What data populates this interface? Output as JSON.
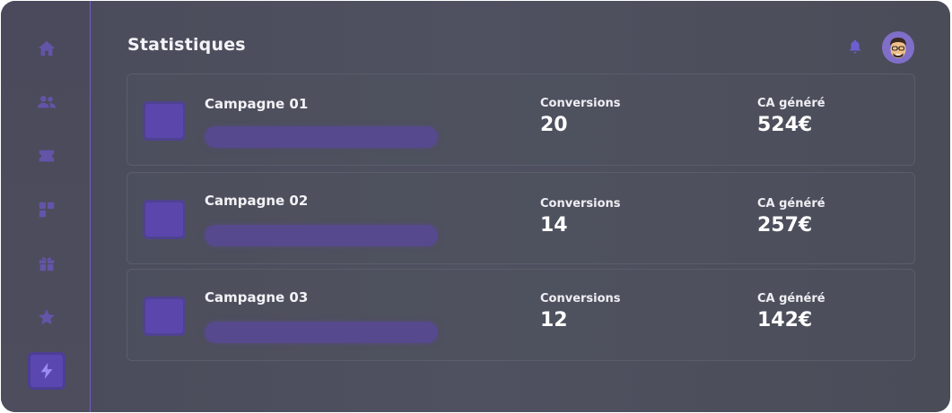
{
  "header": {
    "title": "Statistiques"
  },
  "sidebar": {
    "items": [
      {
        "icon": "home-icon",
        "active": false
      },
      {
        "icon": "users-icon",
        "active": false
      },
      {
        "icon": "ticket-icon",
        "active": false
      },
      {
        "icon": "widgets-icon",
        "active": false
      },
      {
        "icon": "gift-icon",
        "active": false
      },
      {
        "icon": "star-icon",
        "active": false
      },
      {
        "icon": "lightning-icon",
        "active": true
      }
    ]
  },
  "colors": {
    "accent": "#5b47ab",
    "accent_light": "#9a8cf0",
    "text": "#ffffff"
  },
  "campaigns": [
    {
      "name": "Campagne 01",
      "conversions_label": "Conversions",
      "conversions": "20",
      "ca_label": "CA généré",
      "ca": "524€"
    },
    {
      "name": "Campagne 02",
      "conversions_label": "Conversions",
      "conversions": "14",
      "ca_label": "CA généré",
      "ca": "257€"
    },
    {
      "name": "Campagne 03",
      "conversions_label": "Conversions",
      "conversions": "12",
      "ca_label": "CA généré",
      "ca": "142€"
    }
  ]
}
